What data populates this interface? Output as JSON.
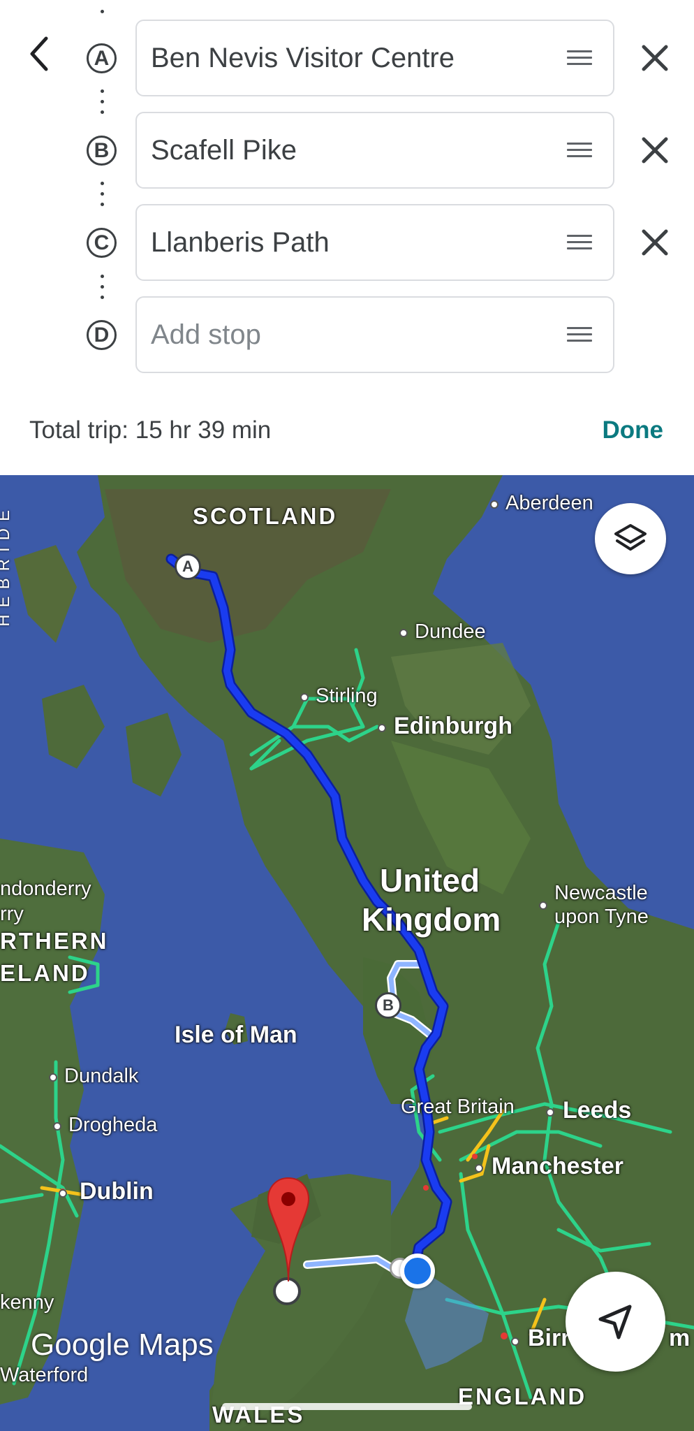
{
  "header": {
    "back_icon": "chevron-left-icon"
  },
  "stops": [
    {
      "letter": "A",
      "label": "Ben Nevis Visitor Centre",
      "placeholder": ""
    },
    {
      "letter": "B",
      "label": "Scafell Pike",
      "placeholder": ""
    },
    {
      "letter": "C",
      "label": "Llanberis Path",
      "placeholder": ""
    },
    {
      "letter": "D",
      "label": "",
      "placeholder": "Add stop"
    }
  ],
  "trip": {
    "total": "Total trip: 15 hr 39 min",
    "done_label": "Done"
  },
  "map": {
    "labels": {
      "scotland": "SCOTLAND",
      "hebrides": "HEBRIDE",
      "aberdeen": "Aberdeen",
      "dundee": "Dundee",
      "stirling": "Stirling",
      "edinburgh": "Edinburgh",
      "uk_line1": "United",
      "uk_line2": "Kingdom",
      "newcastle_line1": "Newcastle",
      "newcastle_line2": "upon Tyne",
      "londonderry_line1": "ndonderry",
      "londonderry_line2": "rry",
      "ni_line1": "RTHERN",
      "ni_line2": "ELAND",
      "isle_of_man": "Isle of Man",
      "dundalk": "Dundalk",
      "drogheda": "Drogheda",
      "dublin": "Dublin",
      "great_britain": "Great Britain",
      "leeds": "Leeds",
      "manchester": "Manchester",
      "kilkenny": "kenny",
      "waterford": "Waterford",
      "birmingham": "Birr",
      "birmingham_tail": "m",
      "wales": "WALES",
      "england": "ENGLAND"
    },
    "route_markers": [
      "A",
      "B"
    ],
    "watermark": "Google Maps",
    "layers_icon": "layers-icon",
    "navigate_icon": "navigation-arrow-icon",
    "colors": {
      "route_primary": "#1a3cf0",
      "route_alt": "#8fb5ff",
      "traffic_green": "#2dd38a",
      "traffic_yellow": "#f4c21b",
      "destination_pin": "#e53935",
      "location_dot": "#1a73e8",
      "water": "#3c5aa8"
    }
  }
}
